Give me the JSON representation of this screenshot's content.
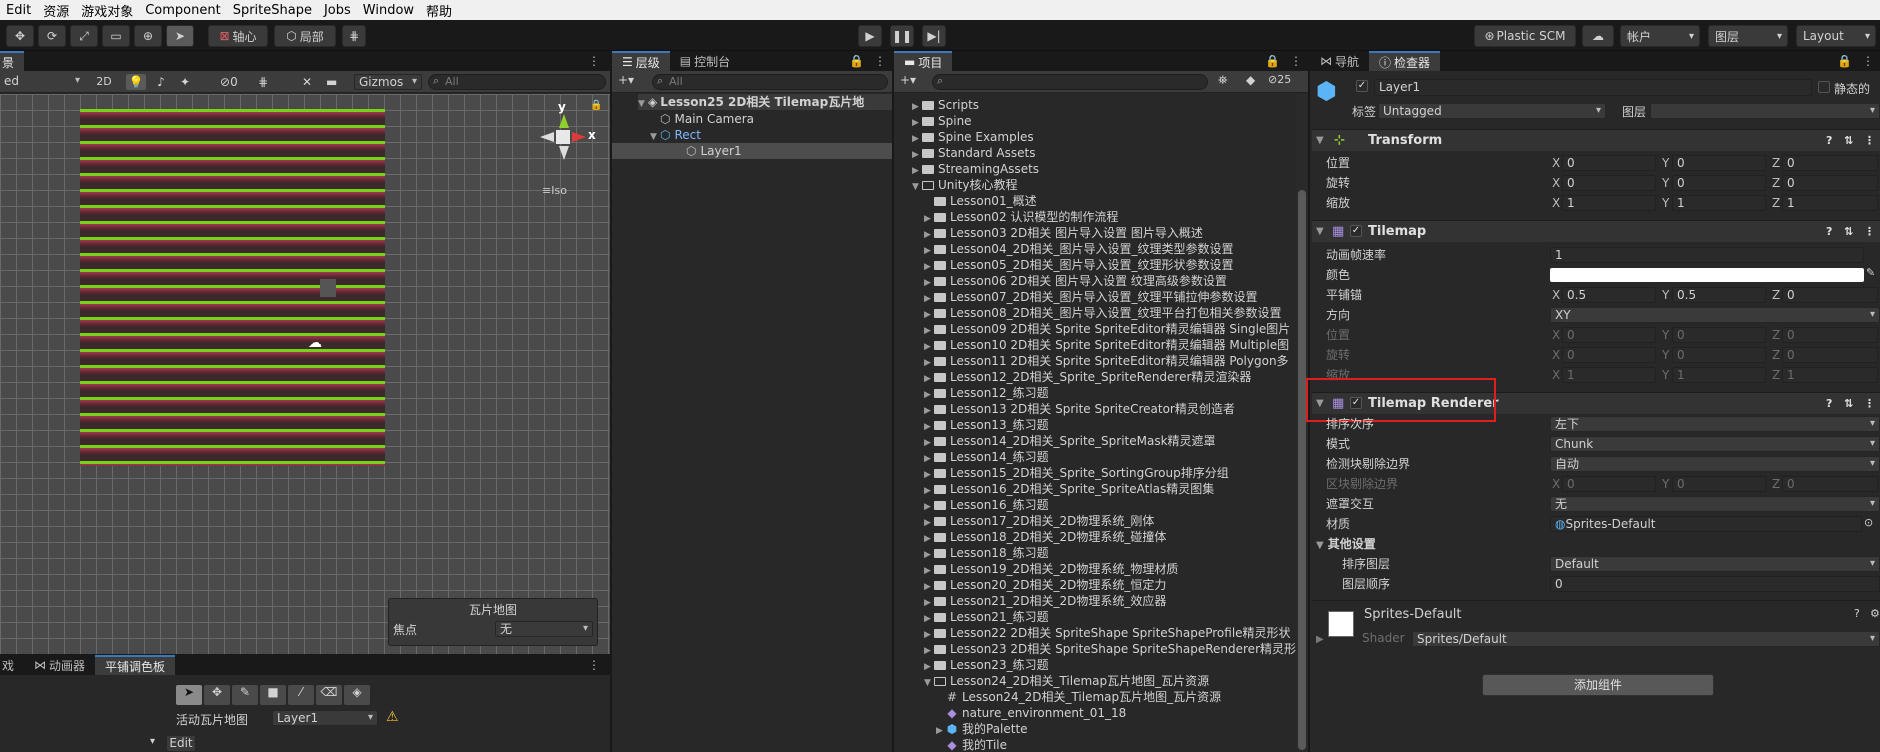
{
  "menubar": [
    "Edit",
    "资源",
    "游戏对象",
    "Component",
    "SpriteShape",
    "Jobs",
    "Window",
    "帮助"
  ],
  "toolbar": {
    "pivot_label": "轴心",
    "local_label": "局部",
    "plastic_label": "Plastic SCM",
    "account_label": "帐户",
    "layers_label": "图层",
    "layout_label": "Layout"
  },
  "scene": {
    "tab_label": "景",
    "mode_value": "ed",
    "btn_2d": "2D",
    "fx_count": "0",
    "gizmos_label": "Gizmos",
    "search_placeholder": "All",
    "axis_x": "x",
    "axis_y": "y",
    "iso_label": "Iso",
    "overlay": {
      "title": "瓦片地图",
      "focus_label": "焦点",
      "focus_value": "无"
    }
  },
  "palette": {
    "tabs": [
      "戏",
      "动画器",
      "平铺调色板"
    ],
    "active_tilemap_label": "活动瓦片地图",
    "active_tilemap_value": "Layer1",
    "edit_label": "Edit"
  },
  "hierarchy": {
    "tabs": [
      "层级",
      "控制台"
    ],
    "search_placeholder": "All",
    "scene_name": "Lesson25 2D相关 Tilemap瓦片地",
    "items": [
      "Main Camera",
      "Rect",
      "Layer1"
    ]
  },
  "project": {
    "tab_label": "项目",
    "search_placeholder": "",
    "badge": "25",
    "folders": [
      "Scripts",
      "Spine",
      "Spine Examples",
      "Standard Assets",
      "StreamingAssets",
      "Unity核心教程"
    ],
    "lessons": [
      "Lesson01_概述",
      "Lesson02 认识模型的制作流程",
      "Lesson03 2D相关 图片导入设置 图片导入概述",
      "Lesson04_2D相关_图片导入设置_纹理类型参数设置",
      "Lesson05_2D相关_图片导入设置_纹理形状参数设置",
      "Lesson06 2D相关 图片导入设置 纹理高级参数设置",
      "Lesson07_2D相关_图片导入设置_纹理平铺拉伸参数设置",
      "Lesson08_2D相关_图片导入设置_纹理平台打包相关参数设置",
      "Lesson09 2D相关 Sprite SpriteEditor精灵编辑器 Single图片",
      "Lesson10 2D相关 Sprite SpriteEditor精灵编辑器 Multiple图",
      "Lesson11 2D相关 Sprite SpriteEditor精灵编辑器 Polygon多",
      "Lesson12_2D相关_Sprite_SpriteRenderer精灵渲染器",
      "Lesson12_练习题",
      "Lesson13 2D相关 Sprite SpriteCreator精灵创造者",
      "Lesson13_练习题",
      "Lesson14_2D相关_Sprite_SpriteMask精灵遮罩",
      "Lesson14_练习题",
      "Lesson15_2D相关_Sprite_SortingGroup排序分组",
      "Lesson16_2D相关_Sprite_SpriteAtlas精灵图集",
      "Lesson16_练习题",
      "Lesson17_2D相关_2D物理系统_刚体",
      "Lesson18_2D相关_2D物理系统_碰撞体",
      "Lesson18_练习题",
      "Lesson19_2D相关_2D物理系统_物理材质",
      "Lesson20_2D相关_2D物理系统_恒定力",
      "Lesson21_2D相关_2D物理系统_效应器",
      "Lesson21_练习题",
      "Lesson22 2D相关 SpriteShape SpriteShapeProfile精灵形状",
      "Lesson23 2D相关 SpriteShape SpriteShapeRenderer精灵形",
      "Lesson23_练习题",
      "Lesson24_2D相关_Tilemap瓦片地图_瓦片资源"
    ],
    "lesson24_children": [
      "Lesson24_2D相关_Tilemap瓦片地图_瓦片资源",
      "nature_environment_01_18",
      "我的Palette",
      "我的Tile"
    ]
  },
  "inspector": {
    "tabs": [
      "导航",
      "检查器"
    ],
    "object_name": "Layer1",
    "static_label": "静态的",
    "tag_label": "标签",
    "tag_value": "Untagged",
    "layer_label": "图层",
    "layer_value": "",
    "transform": {
      "title": "Transform",
      "rows": [
        {
          "label": "位置",
          "x": "0",
          "y": "0",
          "z": "0"
        },
        {
          "label": "旋转",
          "x": "0",
          "y": "0",
          "z": "0"
        },
        {
          "label": "缩放",
          "x": "1",
          "y": "1",
          "z": "1"
        }
      ]
    },
    "tilemap": {
      "title": "Tilemap",
      "frame_rate_label": "动画帧速率",
      "frame_rate_value": "1",
      "color_label": "颜色",
      "color_value": "#ffffff",
      "anchor_label": "平铺锚",
      "anchor": {
        "x": "0.5",
        "y": "0.5",
        "z": "0"
      },
      "orientation_label": "方向",
      "orientation_value": "XY",
      "disabled_rows": [
        {
          "label": "位置",
          "x": "0",
          "y": "0",
          "z": "0"
        },
        {
          "label": "旋转",
          "x": "0",
          "y": "0",
          "z": "0"
        },
        {
          "label": "缩放",
          "x": "1",
          "y": "1",
          "z": "1"
        }
      ]
    },
    "renderer": {
      "title": "Tilemap Renderer",
      "sort_order_label": "排序次序",
      "sort_order_value": "左下",
      "mode_label": "模式",
      "mode_value": "Chunk",
      "detect_label": "检测块剔除边界",
      "detect_value": "自动",
      "bounds_label": "区块剔除边界",
      "bounds": {
        "x": "0",
        "y": "0",
        "z": "0"
      },
      "mask_label": "遮罩交互",
      "mask_value": "无",
      "material_label": "材质",
      "material_value": "Sprites-Default",
      "other_label": "其他设置",
      "sorting_layer_label": "排序图层",
      "sorting_layer_value": "Default",
      "order_label": "图层顺序",
      "order_value": "0"
    },
    "material": {
      "name": "Sprites-Default",
      "shader_label": "Shader",
      "shader_value": "Sprites/Default"
    },
    "add_component_label": "添加组件"
  },
  "colors": {
    "accent_blue": "#3a79bb",
    "highlight_red": "#e01e1e",
    "tile_grass": "#7ad11a",
    "tile_dirt": "#9b3b4d"
  }
}
